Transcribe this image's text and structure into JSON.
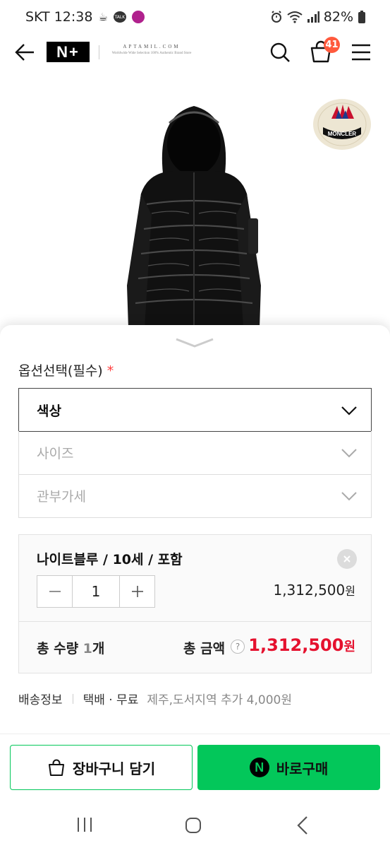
{
  "status_bar": {
    "carrier_time": "SKT 12:38",
    "talk_icon_text": "TALK",
    "battery": "82%"
  },
  "header": {
    "logo_text": "N+",
    "store_name": "APTAMIL.COM",
    "store_tagline": "Worldwide Wide Selection 100% Authentic Brand Store",
    "cart_count": "41"
  },
  "product": {
    "brand_badge_text": "MONCLER"
  },
  "options": {
    "title": "옵션선택(필수)",
    "required_mark": "*",
    "selects": [
      {
        "label": "색상",
        "state": "active"
      },
      {
        "label": "사이즈",
        "state": "disabled"
      },
      {
        "label": "관부가세",
        "state": "disabled"
      }
    ]
  },
  "selected_item": {
    "name": "나이트블루 / 10세 / 포함",
    "quantity": "1",
    "price": "1,312,500",
    "currency": "원"
  },
  "totals": {
    "qty_prefix": "총 수량 ",
    "qty_value": "1",
    "qty_suffix": "개",
    "amount_label": "총 금액",
    "help": "?",
    "amount": "1,312,500",
    "currency": "원"
  },
  "shipping": {
    "label": "배송정보",
    "method": "택배 · 무료",
    "extra": "제주,도서지역 추가 4,000원"
  },
  "actions": {
    "cart_label": "장바구니 담기",
    "buy_label": "바로구매",
    "npay_letter": "N"
  },
  "colors": {
    "accent_green": "#03c75a",
    "price_red": "#e5112e",
    "badge_orange": "#ff5a3d"
  }
}
